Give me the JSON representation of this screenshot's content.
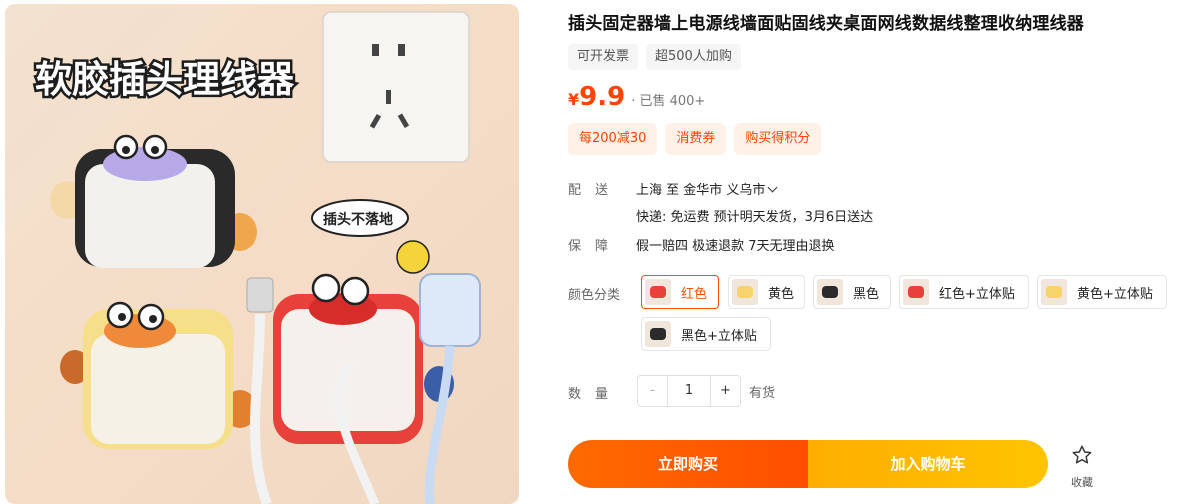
{
  "hero": {
    "banner_text": "软胶插头理线器",
    "bubble_text": "插头不落地"
  },
  "product": {
    "title": "插头固定器墙上电源线墙面贴固线夹桌面网线数据线整理收纳理线器",
    "tags": [
      "可开发票",
      "超500人加购"
    ],
    "price_symbol": "¥",
    "price": "9.9",
    "sold": "· 已售 400+",
    "promos": [
      "每200减30",
      "消费券",
      "购买得积分"
    ]
  },
  "shipping": {
    "label": "配送",
    "route": "上海  至  金华市 义乌市",
    "detail": "快递: 免运费  预计明天发货，3月6日送达"
  },
  "guarantee": {
    "label": "保障",
    "value": "假一赔四 极速退款 7天无理由退换"
  },
  "sku": {
    "label": "颜色分类",
    "options": [
      {
        "label": "红色",
        "swatch": "#e8403a"
      },
      {
        "label": "黄色",
        "swatch": "#f7d36b"
      },
      {
        "label": "黑色",
        "swatch": "#2b2b2b"
      },
      {
        "label": "红色+立体贴",
        "swatch": "#e8403a"
      },
      {
        "label": "黄色+立体贴",
        "swatch": "#f7d36b"
      },
      {
        "label": "黑色+立体贴",
        "swatch": "#2b2b2b"
      }
    ],
    "selected": "红色"
  },
  "quantity": {
    "label": "数量",
    "minus": "-",
    "value": "1",
    "plus": "+",
    "stock": "有货"
  },
  "actions": {
    "buy_now": "立即购买",
    "add_to_cart": "加入购物车",
    "favorite": "收藏"
  },
  "colors": {
    "accent": "#ff4400",
    "buy_gradient": [
      "#ff6a00",
      "#ff4e00"
    ],
    "cart_gradient": [
      "#ffae00",
      "#ffc400"
    ],
    "promo_bg": "#fff0e8"
  }
}
